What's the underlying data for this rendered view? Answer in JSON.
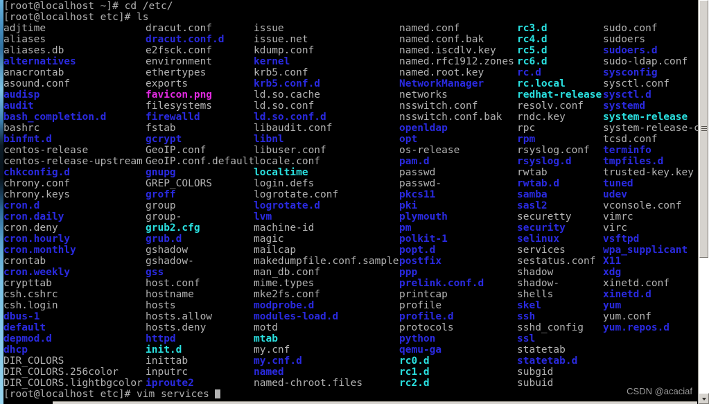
{
  "terminal": {
    "host_prompt": "[root@localhost ~]#",
    "dir_prompt": "[root@localhost etc]#",
    "lines": {
      "cmd_cd": "[root@localhost ~]# cd /etc/",
      "cmd_ls": "[root@localhost etc]# ls",
      "cmd_vim": "[root@localhost etc]# vim services"
    },
    "colors": {
      "background": "#000000",
      "plain_file": "#b2b2b2",
      "directory": "#2a2ae0",
      "symlink": "#2ae0e0",
      "image": "#e02ae0"
    },
    "scrollbar": {
      "arrow_down_icon": "chevron-down-icon",
      "grip_icon": "grip-lines-icon"
    }
  },
  "watermark": "CSDN @acaciaf",
  "listing": {
    "columns": 6,
    "rows": 33,
    "grid": [
      [
        {
          "name": "adjtime",
          "type": "plain"
        },
        {
          "name": "dracut.conf",
          "type": "plain"
        },
        {
          "name": "issue",
          "type": "plain"
        },
        {
          "name": "named.conf",
          "type": "plain"
        },
        {
          "name": "rc3.d",
          "type": "link"
        },
        {
          "name": "sudo.conf",
          "type": "plain"
        }
      ],
      [
        {
          "name": "aliases",
          "type": "plain"
        },
        {
          "name": "dracut.conf.d",
          "type": "dir"
        },
        {
          "name": "issue.net",
          "type": "plain"
        },
        {
          "name": "named.conf.bak",
          "type": "plain"
        },
        {
          "name": "rc4.d",
          "type": "link"
        },
        {
          "name": "sudoers",
          "type": "plain"
        }
      ],
      [
        {
          "name": "aliases.db",
          "type": "plain"
        },
        {
          "name": "e2fsck.conf",
          "type": "plain"
        },
        {
          "name": "kdump.conf",
          "type": "plain"
        },
        {
          "name": "named.iscdlv.key",
          "type": "plain"
        },
        {
          "name": "rc5.d",
          "type": "link"
        },
        {
          "name": "sudoers.d",
          "type": "dir"
        }
      ],
      [
        {
          "name": "alternatives",
          "type": "dir"
        },
        {
          "name": "environment",
          "type": "plain"
        },
        {
          "name": "kernel",
          "type": "dir"
        },
        {
          "name": "named.rfc1912.zones",
          "type": "plain"
        },
        {
          "name": "rc6.d",
          "type": "link"
        },
        {
          "name": "sudo-ldap.conf",
          "type": "plain"
        }
      ],
      [
        {
          "name": "anacrontab",
          "type": "plain"
        },
        {
          "name": "ethertypes",
          "type": "plain"
        },
        {
          "name": "krb5.conf",
          "type": "plain"
        },
        {
          "name": "named.root.key",
          "type": "plain"
        },
        {
          "name": "rc.d",
          "type": "dir"
        },
        {
          "name": "sysconfig",
          "type": "dir"
        }
      ],
      [
        {
          "name": "asound.conf",
          "type": "plain"
        },
        {
          "name": "exports",
          "type": "plain"
        },
        {
          "name": "krb5.conf.d",
          "type": "dir"
        },
        {
          "name": "NetworkManager",
          "type": "dir"
        },
        {
          "name": "rc.local",
          "type": "link"
        },
        {
          "name": "sysctl.conf",
          "type": "plain"
        }
      ],
      [
        {
          "name": "audisp",
          "type": "dir"
        },
        {
          "name": "favicon.png",
          "type": "image"
        },
        {
          "name": "ld.so.cache",
          "type": "plain"
        },
        {
          "name": "networks",
          "type": "plain"
        },
        {
          "name": "redhat-release",
          "type": "link"
        },
        {
          "name": "sysctl.d",
          "type": "dir"
        }
      ],
      [
        {
          "name": "audit",
          "type": "dir"
        },
        {
          "name": "filesystems",
          "type": "plain"
        },
        {
          "name": "ld.so.conf",
          "type": "plain"
        },
        {
          "name": "nsswitch.conf",
          "type": "plain"
        },
        {
          "name": "resolv.conf",
          "type": "plain"
        },
        {
          "name": "systemd",
          "type": "dir"
        }
      ],
      [
        {
          "name": "bash_completion.d",
          "type": "dir"
        },
        {
          "name": "firewalld",
          "type": "dir"
        },
        {
          "name": "ld.so.conf.d",
          "type": "dir"
        },
        {
          "name": "nsswitch.conf.bak",
          "type": "plain"
        },
        {
          "name": "rndc.key",
          "type": "plain"
        },
        {
          "name": "system-release",
          "type": "link"
        }
      ],
      [
        {
          "name": "bashrc",
          "type": "plain"
        },
        {
          "name": "fstab",
          "type": "plain"
        },
        {
          "name": "libaudit.conf",
          "type": "plain"
        },
        {
          "name": "openldap",
          "type": "dir"
        },
        {
          "name": "rpc",
          "type": "plain"
        },
        {
          "name": "system-release-cpe",
          "type": "plain"
        }
      ],
      [
        {
          "name": "binfmt.d",
          "type": "dir"
        },
        {
          "name": "gcrypt",
          "type": "dir"
        },
        {
          "name": "libnl",
          "type": "dir"
        },
        {
          "name": "opt",
          "type": "dir"
        },
        {
          "name": "rpm",
          "type": "dir"
        },
        {
          "name": "tcsd.conf",
          "type": "plain"
        }
      ],
      [
        {
          "name": "centos-release",
          "type": "plain"
        },
        {
          "name": "GeoIP.conf",
          "type": "plain"
        },
        {
          "name": "libuser.conf",
          "type": "plain"
        },
        {
          "name": "os-release",
          "type": "plain"
        },
        {
          "name": "rsyslog.conf",
          "type": "plain"
        },
        {
          "name": "terminfo",
          "type": "dir"
        }
      ],
      [
        {
          "name": "centos-release-upstream",
          "type": "plain"
        },
        {
          "name": "GeoIP.conf.default",
          "type": "plain"
        },
        {
          "name": "locale.conf",
          "type": "plain"
        },
        {
          "name": "pam.d",
          "type": "dir"
        },
        {
          "name": "rsyslog.d",
          "type": "dir"
        },
        {
          "name": "tmpfiles.d",
          "type": "dir"
        }
      ],
      [
        {
          "name": "chkconfig.d",
          "type": "dir"
        },
        {
          "name": "gnupg",
          "type": "dir"
        },
        {
          "name": "localtime",
          "type": "link"
        },
        {
          "name": "passwd",
          "type": "plain"
        },
        {
          "name": "rwtab",
          "type": "plain"
        },
        {
          "name": "trusted-key.key",
          "type": "plain"
        }
      ],
      [
        {
          "name": "chrony.conf",
          "type": "plain"
        },
        {
          "name": "GREP_COLORS",
          "type": "plain"
        },
        {
          "name": "login.defs",
          "type": "plain"
        },
        {
          "name": "passwd-",
          "type": "plain"
        },
        {
          "name": "rwtab.d",
          "type": "dir"
        },
        {
          "name": "tuned",
          "type": "dir"
        }
      ],
      [
        {
          "name": "chrony.keys",
          "type": "plain"
        },
        {
          "name": "groff",
          "type": "dir"
        },
        {
          "name": "logrotate.conf",
          "type": "plain"
        },
        {
          "name": "pkcs11",
          "type": "dir"
        },
        {
          "name": "samba",
          "type": "dir"
        },
        {
          "name": "udev",
          "type": "dir"
        }
      ],
      [
        {
          "name": "cron.d",
          "type": "dir"
        },
        {
          "name": "group",
          "type": "plain"
        },
        {
          "name": "logrotate.d",
          "type": "dir"
        },
        {
          "name": "pki",
          "type": "dir"
        },
        {
          "name": "sasl2",
          "type": "dir"
        },
        {
          "name": "vconsole.conf",
          "type": "plain"
        }
      ],
      [
        {
          "name": "cron.daily",
          "type": "dir"
        },
        {
          "name": "group-",
          "type": "plain"
        },
        {
          "name": "lvm",
          "type": "dir"
        },
        {
          "name": "plymouth",
          "type": "dir"
        },
        {
          "name": "securetty",
          "type": "plain"
        },
        {
          "name": "vimrc",
          "type": "plain"
        }
      ],
      [
        {
          "name": "cron.deny",
          "type": "plain"
        },
        {
          "name": "grub2.cfg",
          "type": "link"
        },
        {
          "name": "machine-id",
          "type": "plain"
        },
        {
          "name": "pm",
          "type": "dir"
        },
        {
          "name": "security",
          "type": "dir"
        },
        {
          "name": "virc",
          "type": "plain"
        }
      ],
      [
        {
          "name": "cron.hourly",
          "type": "dir"
        },
        {
          "name": "grub.d",
          "type": "dir"
        },
        {
          "name": "magic",
          "type": "plain"
        },
        {
          "name": "polkit-1",
          "type": "dir"
        },
        {
          "name": "selinux",
          "type": "dir"
        },
        {
          "name": "vsftpd",
          "type": "dir"
        }
      ],
      [
        {
          "name": "cron.monthly",
          "type": "dir"
        },
        {
          "name": "gshadow",
          "type": "plain"
        },
        {
          "name": "mailcap",
          "type": "plain"
        },
        {
          "name": "popt.d",
          "type": "dir"
        },
        {
          "name": "services",
          "type": "plain"
        },
        {
          "name": "wpa_supplicant",
          "type": "dir"
        }
      ],
      [
        {
          "name": "crontab",
          "type": "plain"
        },
        {
          "name": "gshadow-",
          "type": "plain"
        },
        {
          "name": "makedumpfile.conf.sample",
          "type": "plain"
        },
        {
          "name": "postfix",
          "type": "dir"
        },
        {
          "name": "sestatus.conf",
          "type": "plain"
        },
        {
          "name": "X11",
          "type": "dir"
        }
      ],
      [
        {
          "name": "cron.weekly",
          "type": "dir"
        },
        {
          "name": "gss",
          "type": "dir"
        },
        {
          "name": "man_db.conf",
          "type": "plain"
        },
        {
          "name": "ppp",
          "type": "dir"
        },
        {
          "name": "shadow",
          "type": "plain"
        },
        {
          "name": "xdg",
          "type": "dir"
        }
      ],
      [
        {
          "name": "crypttab",
          "type": "plain"
        },
        {
          "name": "host.conf",
          "type": "plain"
        },
        {
          "name": "mime.types",
          "type": "plain"
        },
        {
          "name": "prelink.conf.d",
          "type": "dir"
        },
        {
          "name": "shadow-",
          "type": "plain"
        },
        {
          "name": "xinetd.conf",
          "type": "plain"
        }
      ],
      [
        {
          "name": "csh.cshrc",
          "type": "plain"
        },
        {
          "name": "hostname",
          "type": "plain"
        },
        {
          "name": "mke2fs.conf",
          "type": "plain"
        },
        {
          "name": "printcap",
          "type": "plain"
        },
        {
          "name": "shells",
          "type": "plain"
        },
        {
          "name": "xinetd.d",
          "type": "dir"
        }
      ],
      [
        {
          "name": "csh.login",
          "type": "plain"
        },
        {
          "name": "hosts",
          "type": "plain"
        },
        {
          "name": "modprobe.d",
          "type": "dir"
        },
        {
          "name": "profile",
          "type": "plain"
        },
        {
          "name": "skel",
          "type": "dir"
        },
        {
          "name": "yum",
          "type": "dir"
        }
      ],
      [
        {
          "name": "dbus-1",
          "type": "dir"
        },
        {
          "name": "hosts.allow",
          "type": "plain"
        },
        {
          "name": "modules-load.d",
          "type": "dir"
        },
        {
          "name": "profile.d",
          "type": "dir"
        },
        {
          "name": "ssh",
          "type": "dir"
        },
        {
          "name": "yum.conf",
          "type": "plain"
        }
      ],
      [
        {
          "name": "default",
          "type": "dir"
        },
        {
          "name": "hosts.deny",
          "type": "plain"
        },
        {
          "name": "motd",
          "type": "plain"
        },
        {
          "name": "protocols",
          "type": "plain"
        },
        {
          "name": "sshd_config",
          "type": "plain"
        },
        {
          "name": "yum.repos.d",
          "type": "dir"
        }
      ],
      [
        {
          "name": "depmod.d",
          "type": "dir"
        },
        {
          "name": "httpd",
          "type": "dir"
        },
        {
          "name": "mtab",
          "type": "link"
        },
        {
          "name": "python",
          "type": "dir"
        },
        {
          "name": "ssl",
          "type": "dir"
        },
        {
          "name": "",
          "type": "plain"
        }
      ],
      [
        {
          "name": "dhcp",
          "type": "dir"
        },
        {
          "name": "init.d",
          "type": "link"
        },
        {
          "name": "my.cnf",
          "type": "plain"
        },
        {
          "name": "qemu-ga",
          "type": "dir"
        },
        {
          "name": "statetab",
          "type": "plain"
        },
        {
          "name": "",
          "type": "plain"
        }
      ],
      [
        {
          "name": "DIR_COLORS",
          "type": "plain"
        },
        {
          "name": "inittab",
          "type": "plain"
        },
        {
          "name": "my.cnf.d",
          "type": "dir"
        },
        {
          "name": "rc0.d",
          "type": "link"
        },
        {
          "name": "statetab.d",
          "type": "dir"
        },
        {
          "name": "",
          "type": "plain"
        }
      ],
      [
        {
          "name": "DIR_COLORS.256color",
          "type": "plain"
        },
        {
          "name": "inputrc",
          "type": "plain"
        },
        {
          "name": "named",
          "type": "dir"
        },
        {
          "name": "rc1.d",
          "type": "link"
        },
        {
          "name": "subgid",
          "type": "plain"
        },
        {
          "name": "",
          "type": "plain"
        }
      ],
      [
        {
          "name": "DIR_COLORS.lightbgcolor",
          "type": "plain"
        },
        {
          "name": "iproute2",
          "type": "dir"
        },
        {
          "name": "named-chroot.files",
          "type": "plain"
        },
        {
          "name": "rc2.d",
          "type": "link"
        },
        {
          "name": "subuid",
          "type": "plain"
        },
        {
          "name": "",
          "type": "plain"
        }
      ]
    ]
  }
}
